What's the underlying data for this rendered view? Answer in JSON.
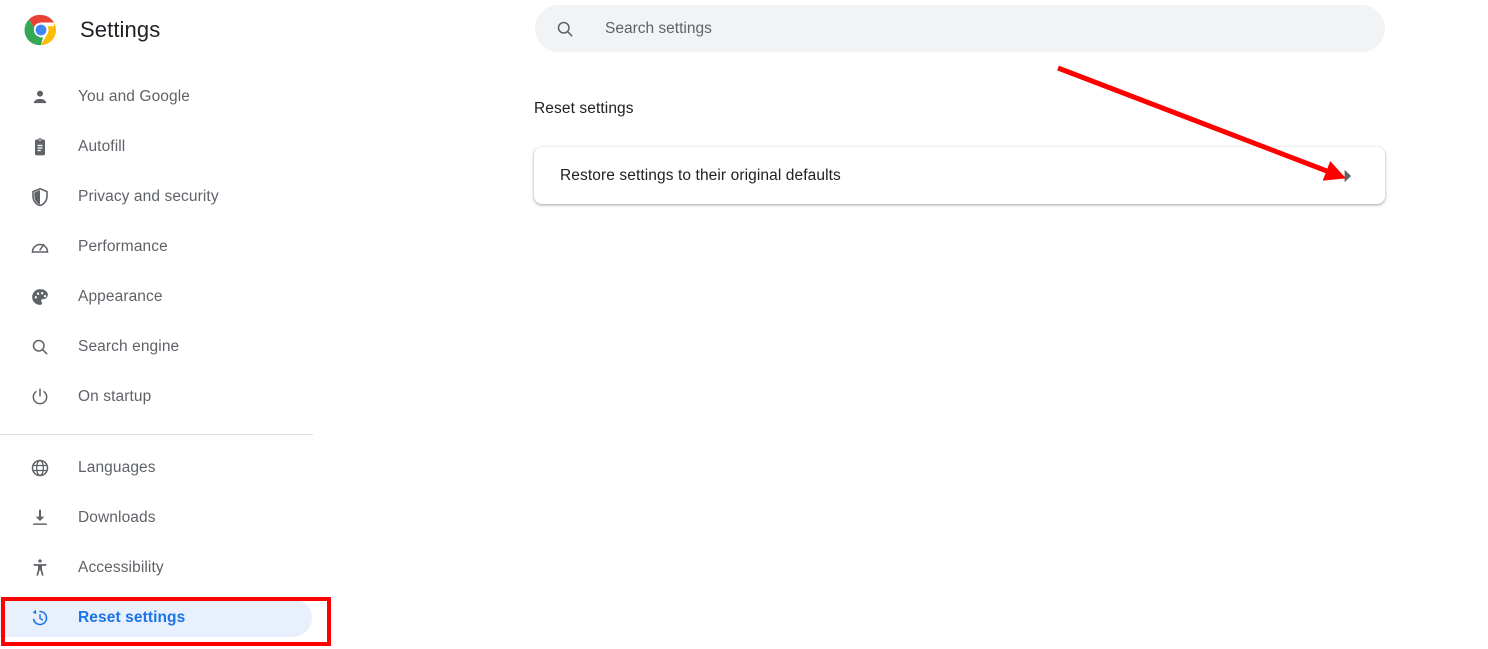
{
  "brand": {
    "logo": "chrome-logo",
    "title": "Settings"
  },
  "sidebar": {
    "primary_items": [
      {
        "label": "You and Google",
        "icon": "person-icon",
        "selected": false
      },
      {
        "label": "Autofill",
        "icon": "clipboard-icon",
        "selected": false
      },
      {
        "label": "Privacy and security",
        "icon": "shield-icon",
        "selected": false
      },
      {
        "label": "Performance",
        "icon": "speedometer-icon",
        "selected": false
      },
      {
        "label": "Appearance",
        "icon": "palette-icon",
        "selected": false
      },
      {
        "label": "Search engine",
        "icon": "search-icon",
        "selected": false
      },
      {
        "label": "On startup",
        "icon": "power-icon",
        "selected": false
      }
    ],
    "secondary_items": [
      {
        "label": "Languages",
        "icon": "globe-icon",
        "selected": false
      },
      {
        "label": "Downloads",
        "icon": "download-icon",
        "selected": false
      },
      {
        "label": "Accessibility",
        "icon": "accessibility-icon",
        "selected": false
      },
      {
        "label": "Reset settings",
        "icon": "restore-history-icon",
        "selected": true
      }
    ]
  },
  "search": {
    "placeholder": "Search settings",
    "value": "",
    "icon": "search-icon"
  },
  "main": {
    "section_title": "Reset settings",
    "reset_card": {
      "label": "Restore settings to their original defaults",
      "chevron": "chevron-right-icon"
    }
  },
  "annotations": {
    "highlight_color": "#fe0000",
    "box_target": "Reset settings",
    "arrow_target": "chevron-right-icon"
  },
  "colors": {
    "accent_blue": "#1a73e8",
    "selected_pill": "#e8f0fe",
    "text_primary": "#202124",
    "text_secondary": "#5f6368",
    "search_background": "#f1f3f4",
    "annotation_red": "#fe0000"
  }
}
